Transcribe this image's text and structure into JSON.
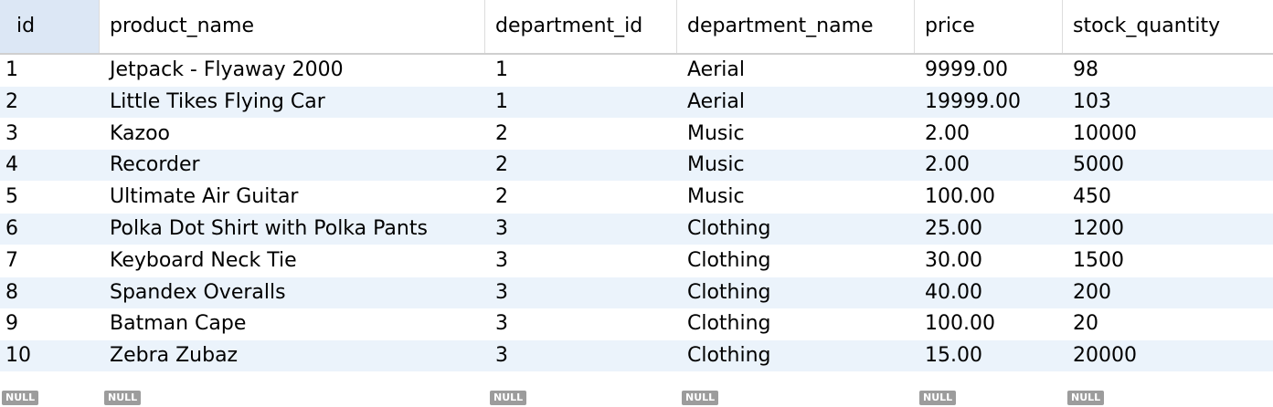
{
  "columns": [
    "id",
    "product_name",
    "department_id",
    "department_name",
    "price",
    "stock_quantity"
  ],
  "rows": [
    [
      "1",
      "Jetpack - Flyaway 2000",
      "1",
      "Aerial",
      "9999.00",
      "98"
    ],
    [
      "2",
      "Little Tikes Flying Car",
      "1",
      "Aerial",
      "19999.00",
      "103"
    ],
    [
      "3",
      "Kazoo",
      "2",
      "Music",
      "2.00",
      "10000"
    ],
    [
      "4",
      "Recorder",
      "2",
      "Music",
      "2.00",
      "5000"
    ],
    [
      "5",
      "Ultimate Air Guitar",
      "2",
      "Music",
      "100.00",
      "450"
    ],
    [
      "6",
      "Polka Dot Shirt with Polka Pants",
      "3",
      "Clothing",
      "25.00",
      "1200"
    ],
    [
      "7",
      "Keyboard Neck Tie",
      "3",
      "Clothing",
      "30.00",
      "1500"
    ],
    [
      "8",
      "Spandex Overalls",
      "3",
      "Clothing",
      "40.00",
      "200"
    ],
    [
      "9",
      "Batman Cape",
      "3",
      "Clothing",
      "100.00",
      "20"
    ],
    [
      "10",
      "Zebra Zubaz",
      "3",
      "Clothing",
      "15.00",
      "20000"
    ]
  ],
  "null_label": "NULL",
  "colors": {
    "header_selected_bg": "#dce7f5",
    "row_alt_bg": "#ebf3fb",
    "null_badge_bg": "#9c9c9c"
  }
}
